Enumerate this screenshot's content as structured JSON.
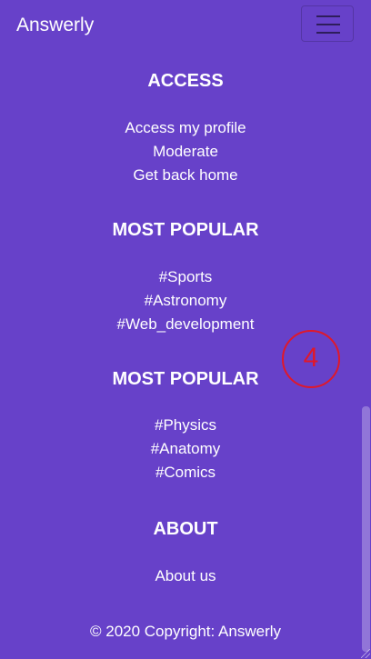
{
  "navbar": {
    "brand": "Answerly",
    "toggler_icon": "hamburger-menu-icon"
  },
  "sections": [
    {
      "heading": "ACCESS",
      "links": [
        "Access my profile",
        "Moderate",
        "Get back home"
      ]
    },
    {
      "heading": "MOST POPULAR",
      "links": [
        "#Sports",
        "#Astronomy",
        "#Web_development"
      ]
    },
    {
      "heading": "MOST POPULAR",
      "links": [
        "#Physics",
        "#Anatomy",
        "#Comics"
      ]
    },
    {
      "heading": "ABOUT",
      "links": [
        "About us"
      ]
    }
  ],
  "annotation": {
    "label": "4",
    "color": "#e0182a"
  },
  "footer": {
    "copyright": "© 2020 Copyright: Answerly"
  },
  "colors": {
    "background": "#6741c9",
    "text": "#ffffff"
  }
}
